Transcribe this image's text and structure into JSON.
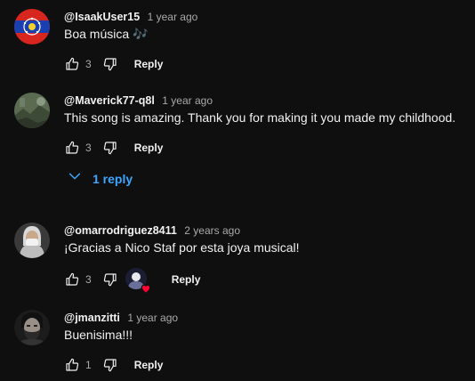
{
  "comments": [
    {
      "author": "@IsaakUser15",
      "time": "1 year ago",
      "text": "Boa música 🎶",
      "likes": "3",
      "reply_label": "Reply"
    },
    {
      "author": "@Maverick77-q8l",
      "time": "1 year ago",
      "text": "This song is amazing. Thank you for making it you made my childhood.",
      "likes": "3",
      "reply_label": "Reply",
      "replies_toggle": "1 reply"
    },
    {
      "author": "@omarrodriguez8411",
      "time": "2 years ago",
      "text": "¡Gracias a Nico Staf por esta joya musical!",
      "likes": "3",
      "reply_label": "Reply",
      "creator_heart": true
    },
    {
      "author": "@jmanzitti",
      "time": "1 year ago",
      "text": "Buenisima!!!",
      "likes": "1",
      "reply_label": "Reply"
    }
  ],
  "icons": {
    "like": "thumbs-up-icon",
    "dislike": "thumbs-down-icon",
    "expand": "chevron-down-icon",
    "heart": "heart-icon"
  },
  "colors": {
    "background": "#0f0f0f",
    "text": "#f1f1f1",
    "secondary_text": "#aaaaaa",
    "link": "#3ea6ff",
    "heart": "#ff0033"
  }
}
